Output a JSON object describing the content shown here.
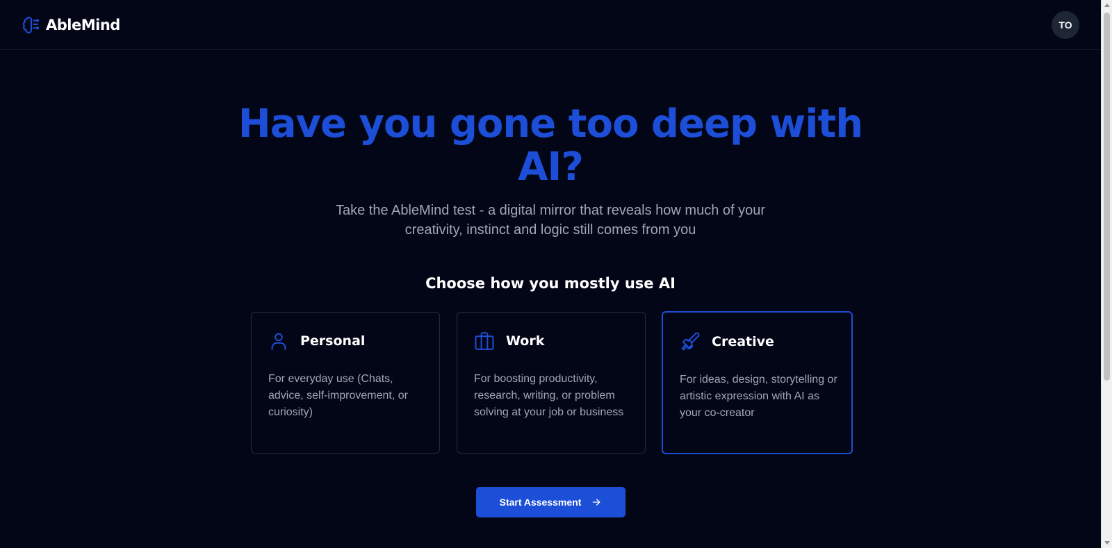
{
  "header": {
    "logo_text": "AbleMind",
    "avatar_initials": "TO"
  },
  "hero": {
    "title": "Have you gone too deep with AI?",
    "subtitle": "Take the AbleMind test - a digital mirror that reveals how much of your creativity, instinct and logic still comes from you"
  },
  "usage": {
    "heading": "Choose how you mostly use AI",
    "selected": "Creative",
    "options": [
      {
        "icon": "user-icon",
        "title": "Personal",
        "description": "For everyday use (Chats, advice, self-improvement, or curiosity)"
      },
      {
        "icon": "briefcase-icon",
        "title": "Work",
        "description": "For boosting productivity, research, writing, or problem solving at your job or business"
      },
      {
        "icon": "paintbrush-icon",
        "title": "Creative",
        "description": "For ideas, design, storytelling or artistic expression with AI as your co-creator"
      }
    ]
  },
  "actions": {
    "start_label": "Start Assessment"
  },
  "colors": {
    "background": "#030617",
    "accent": "#1d4ed8",
    "muted_text": "#a0a7b5",
    "card_border": "#262c3a"
  }
}
